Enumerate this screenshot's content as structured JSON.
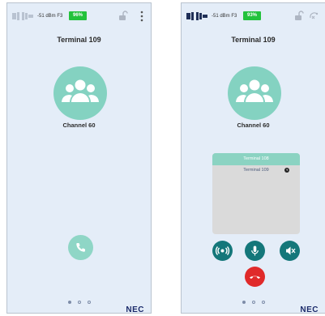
{
  "left": {
    "status": {
      "signal_text": "-51 dBm F3",
      "battery": "96%"
    },
    "terminal_name": "Terminal 109",
    "channel_name": "Channel 60",
    "brand": "NEC"
  },
  "right": {
    "status": {
      "signal_text": "-51 dBm F3",
      "battery": "93%"
    },
    "terminal_name": "Terminal 109",
    "channel_name": "Channel 60",
    "list_header": "Terminal 108",
    "list_items": [
      {
        "label": "Terminal 109"
      }
    ],
    "brand": "NEC"
  },
  "colors": {
    "accent_teal": "#8bd3c2",
    "control_teal": "#14777a",
    "end_call_red": "#e02a2a",
    "battery_green": "#23c23c"
  },
  "pager": {
    "pages": 3,
    "current": 1
  }
}
